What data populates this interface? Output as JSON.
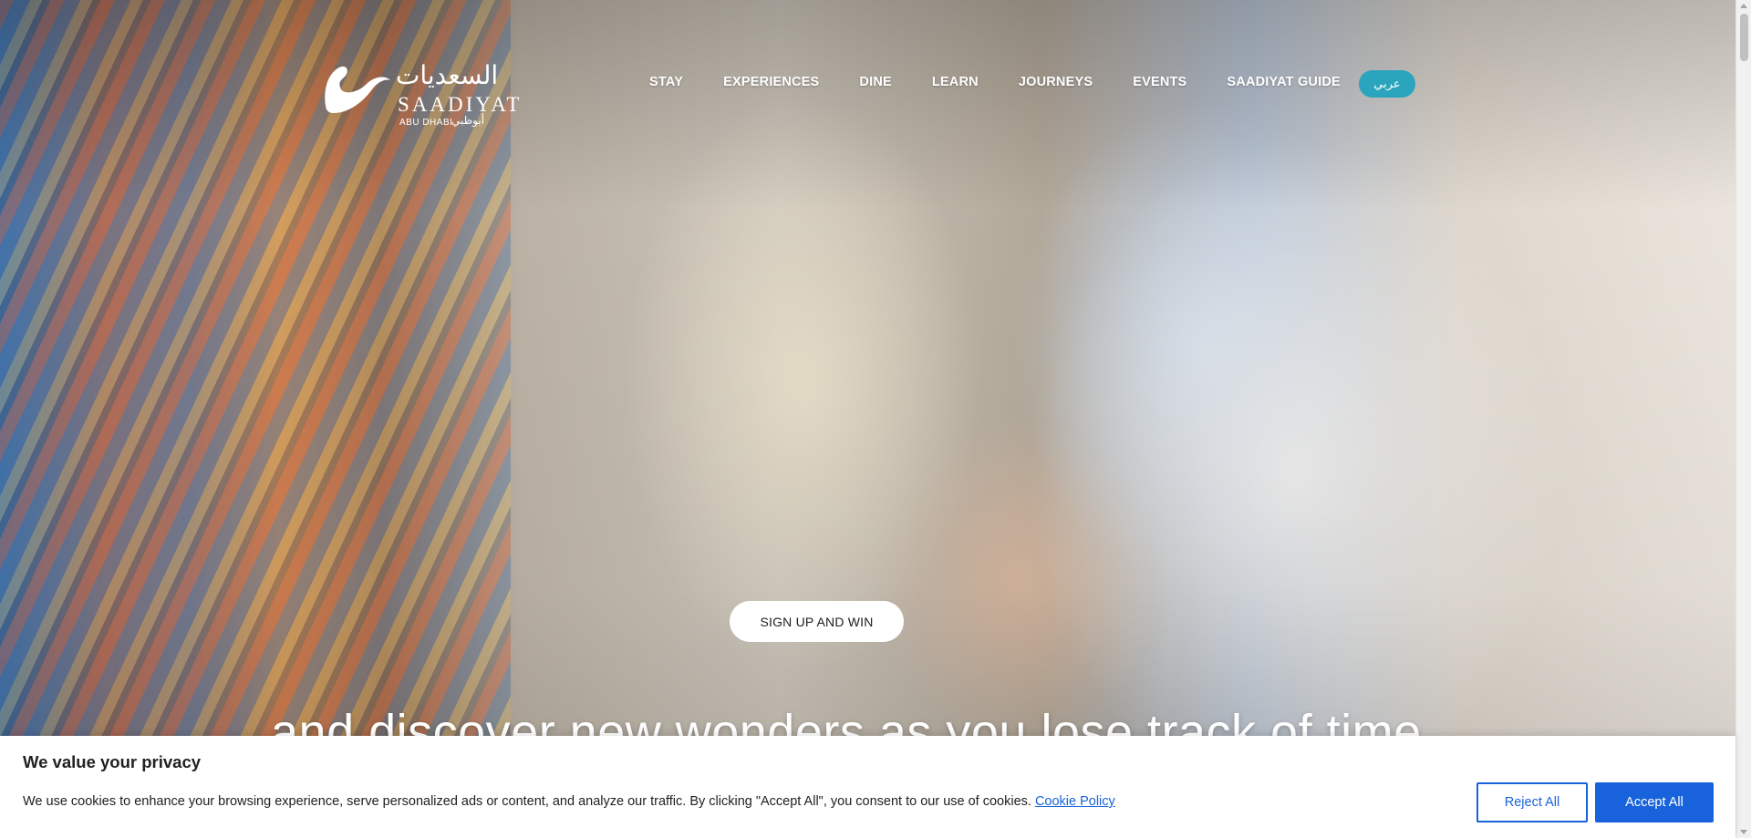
{
  "brand": {
    "name_arabic": "السعديات",
    "name_latin": "SAADIYAT",
    "location_latin": "ABU DHABI",
    "location_arabic": "أبوظبي"
  },
  "nav": {
    "items": [
      "STAY",
      "EXPERIENCES",
      "DINE",
      "LEARN",
      "JOURNEYS",
      "EVENTS",
      "SAADIYAT GUIDE"
    ],
    "language_toggle": "عربي"
  },
  "hero": {
    "cta_label": "SIGN UP AND WIN",
    "tagline": "and discover new wonders as you lose track of time"
  },
  "cookie_banner": {
    "title": "We value your privacy",
    "text": "We use cookies to enhance your browsing experience, serve personalized ads or content, and analyze our traffic. By clicking \"Accept All\", you consent to our use of cookies.",
    "policy_link": "Cookie Policy",
    "reject_label": "Reject All",
    "accept_label": "Accept All"
  },
  "colors": {
    "accent_teal": "#2aa5bd",
    "cookie_blue": "#1863dc",
    "text_dark": "#212121"
  }
}
